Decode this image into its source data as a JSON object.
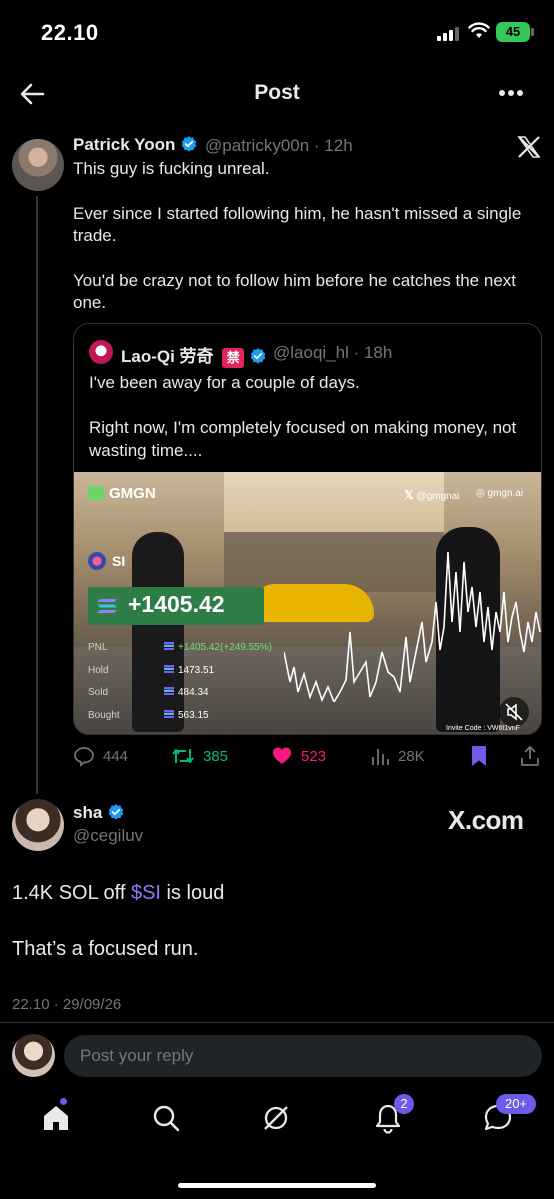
{
  "status": {
    "time": "22.10",
    "battery": "45"
  },
  "header": {
    "title": "Post"
  },
  "parent_post": {
    "name": "Patrick Yoon",
    "handle_time": "@patricky00n · 12h",
    "paragraphs": [
      "This guy is fucking unreal.",
      "Ever since I started following him, he hasn't missed a single trade.",
      "You'd be crazy not to follow him before he catches the next one."
    ],
    "quote": {
      "name": "Lao-Qi 劳奇",
      "ban_badge": "禁",
      "handle_time": "@laoqi_hl · 18h",
      "paragraphs": [
        "I've been away for a couple of days.",
        "Right now, I'm completely focused on making money, not wasting time...."
      ],
      "media": {
        "brand": "GMGN",
        "social_handle": "@gmgnai",
        "site": "gmgn.ai",
        "token": "SI",
        "pnl_headline": "+1405.42",
        "stats": [
          {
            "label": "PNL",
            "value": "+1405.42(+249.55%)",
            "green": true
          },
          {
            "label": "Hold",
            "value": "1473.51",
            "green": false
          },
          {
            "label": "Sold",
            "value": "484.34",
            "green": false
          },
          {
            "label": "Bought",
            "value": "563.15",
            "green": false
          }
        ],
        "invite_code": "Invite Code : VW6t1vnF",
        "chart_color": "#ffffff"
      }
    },
    "actions": {
      "replies": "444",
      "reposts": "385",
      "likes": "523",
      "views": "28K"
    }
  },
  "main_post": {
    "name": "sha",
    "handle": "@cegiluv",
    "watermark": "X.com",
    "text_before_tag": "1.4K SOL off ",
    "cashtag": "$SI",
    "text_after_tag": " is loud",
    "line2": "That’s a focused run.",
    "timestamp": "22.10 · 29/09/26"
  },
  "reply": {
    "placeholder": "Post your reply"
  },
  "nav": {
    "notifications_badge": "2",
    "messages_badge": "20+"
  },
  "colors": {
    "accent": "#1d9bf0",
    "repost": "#00ba7c",
    "like": "#f91880",
    "bookmark": "#6c5ce7",
    "cashtag": "#8b7cf8"
  }
}
